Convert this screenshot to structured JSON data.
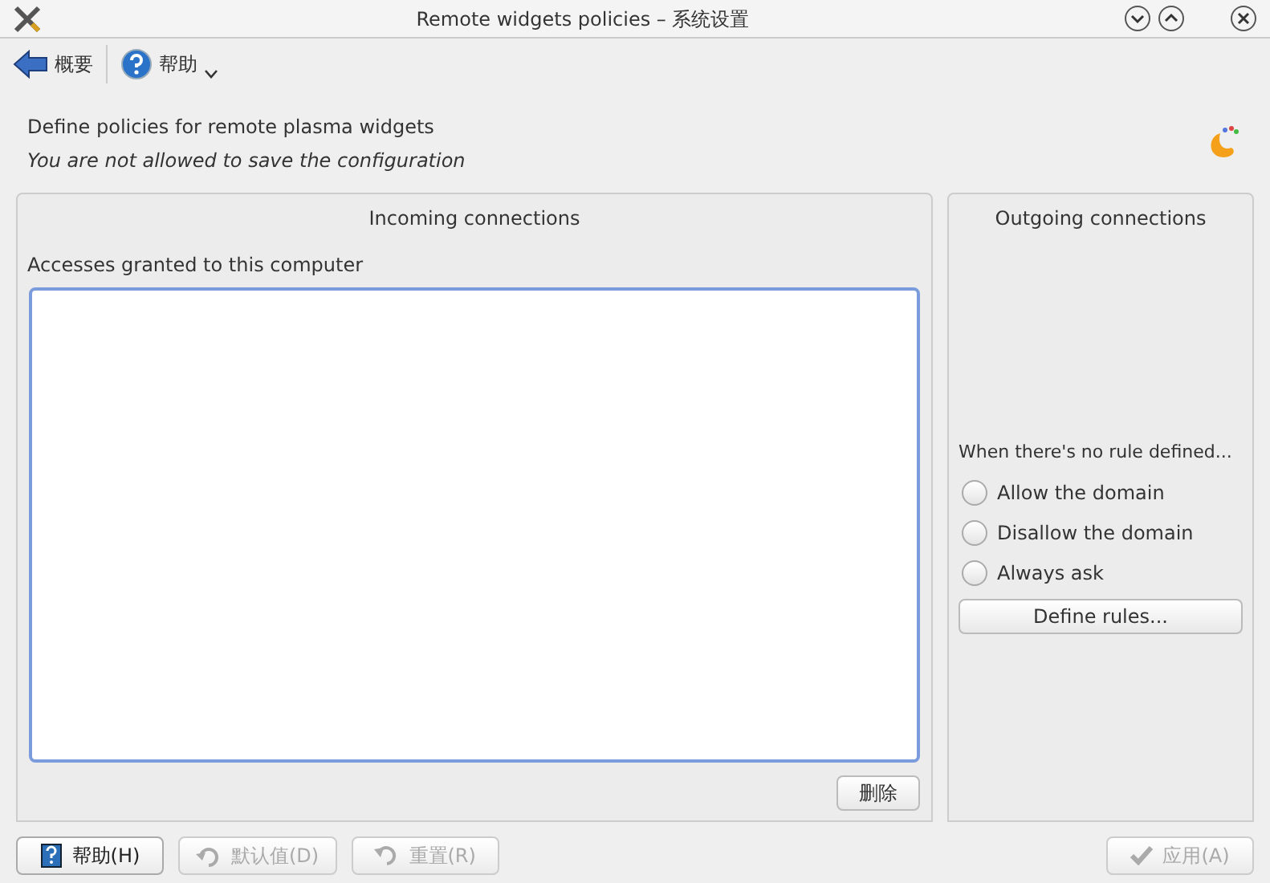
{
  "window": {
    "title": "Remote widgets policies – 系统设置"
  },
  "toolbar": [
    {
      "kind": "back",
      "label": "概要"
    },
    {
      "kind": "help",
      "label": "帮助"
    }
  ],
  "header": {
    "title": "Define policies for remote plasma widgets",
    "notice": "You are not allowed to save the configuration"
  },
  "incoming": {
    "title": "Incoming connections",
    "list_label": "Accesses granted to this computer",
    "delete_button": {
      "label": "删除",
      "disabled": false
    }
  },
  "outgoing": {
    "title": "Outgoing connections",
    "prompt": "When there's no rule defined...",
    "options": [
      {
        "label": "Allow the domain",
        "selected": false
      },
      {
        "label": "Disallow the domain",
        "selected": false
      },
      {
        "label": "Always ask",
        "selected": false
      }
    ],
    "rules_button": "Define rules..."
  },
  "buttons": [
    {
      "kind": "help",
      "label": "帮助(H)",
      "disabled": false
    },
    {
      "kind": "defaults",
      "label": "默认值(D)",
      "disabled": true
    },
    {
      "kind": "reset",
      "label": "重置(R)",
      "disabled": true
    },
    {
      "kind": "apply",
      "label": "应用(A)",
      "disabled": true
    }
  ]
}
